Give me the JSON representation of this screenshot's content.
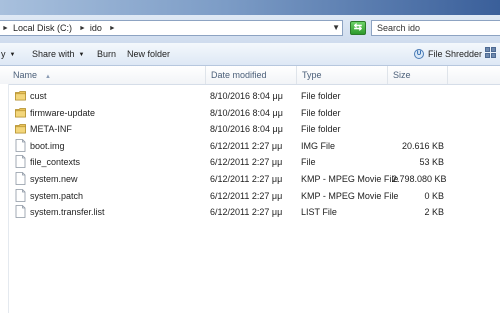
{
  "address": {
    "crumbs": [
      "Local Disk (C:)",
      "ido"
    ],
    "search_placeholder": "Search ido"
  },
  "toolbar": {
    "left_partial": "y",
    "share_label": "Share with",
    "burn_label": "Burn",
    "new_folder_label": "New folder",
    "file_shredder_label": "File Shredder"
  },
  "columns": {
    "name": "Name",
    "date": "Date modified",
    "type": "Type",
    "size": "Size"
  },
  "files": [
    {
      "name": "cust",
      "date": "8/10/2016 8:04 μμ",
      "type": "File folder",
      "size": "",
      "icon": "folder-icon"
    },
    {
      "name": "firmware-update",
      "date": "8/10/2016 8:04 μμ",
      "type": "File folder",
      "size": "",
      "icon": "folder-icon"
    },
    {
      "name": "META-INF",
      "date": "8/10/2016 8:04 μμ",
      "type": "File folder",
      "size": "",
      "icon": "folder-icon"
    },
    {
      "name": "boot.img",
      "date": "6/12/2011 2:27 μμ",
      "type": "IMG File",
      "size": "20.616 KB",
      "icon": "file-icon"
    },
    {
      "name": "file_contexts",
      "date": "6/12/2011 2:27 μμ",
      "type": "File",
      "size": "53 KB",
      "icon": "file-icon"
    },
    {
      "name": "system.new",
      "date": "6/12/2011 2:27 μμ",
      "type": "KMP - MPEG Movie File",
      "size": "2.798.080 KB",
      "icon": "file-icon"
    },
    {
      "name": "system.patch",
      "date": "6/12/2011 2:27 μμ",
      "type": "KMP - MPEG Movie File",
      "size": "0 KB",
      "icon": "file-icon"
    },
    {
      "name": "system.transfer.list",
      "date": "6/12/2011 2:27 μμ",
      "type": "LIST File",
      "size": "2 KB",
      "icon": "file-icon"
    }
  ],
  "colors": {
    "folder": "#e8c25a",
    "header_text": "#4c607a"
  }
}
